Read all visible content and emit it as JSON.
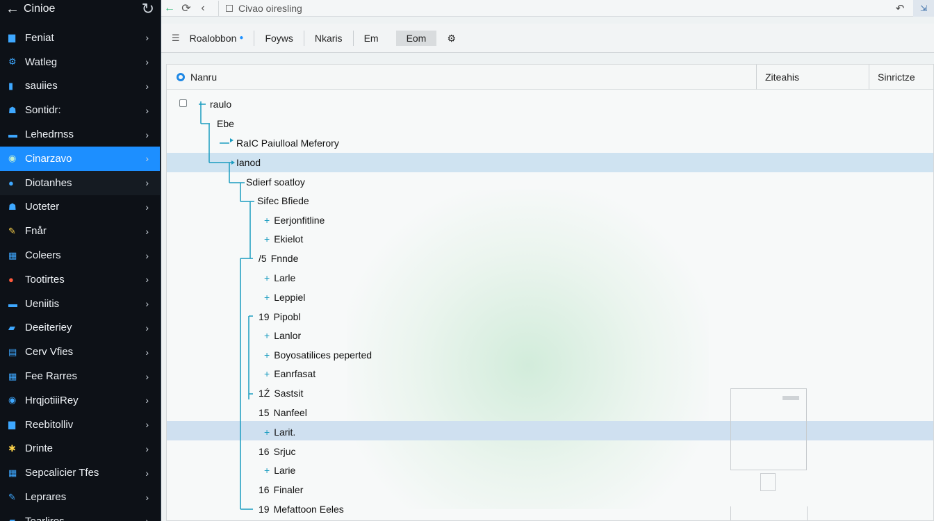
{
  "sidebar": {
    "title": "Cinioe",
    "items": [
      {
        "label": "Feniat",
        "icon": "document-icon"
      },
      {
        "label": "Watleg",
        "icon": "network-icon"
      },
      {
        "label": "sauiies",
        "icon": "book-icon"
      },
      {
        "label": "Sontidr:",
        "icon": "users-icon"
      },
      {
        "label": "Lehedrnss",
        "icon": "card-icon"
      },
      {
        "label": "Cinarzavo",
        "icon": "globe-icon"
      },
      {
        "label": "Diotanhes",
        "icon": "circle-icon"
      },
      {
        "label": "Uoteter",
        "icon": "user-icon"
      },
      {
        "label": "Fnår",
        "icon": "wand-icon"
      },
      {
        "label": "Coleers",
        "icon": "chart-icon"
      },
      {
        "label": "Tootirtes",
        "icon": "person-icon"
      },
      {
        "label": "Ueniitis",
        "icon": "card-icon"
      },
      {
        "label": "Deeiteriey",
        "icon": "folder-icon"
      },
      {
        "label": "Cerv Vfies",
        "icon": "layers-icon"
      },
      {
        "label": "Fee Rarres",
        "icon": "grid-icon"
      },
      {
        "label": "HrqjotiiiRey",
        "icon": "globe-icon"
      },
      {
        "label": "Reebitolliv",
        "icon": "document-icon"
      },
      {
        "label": "Drinte",
        "icon": "star-icon"
      },
      {
        "label": "Sepcalicier Tfes",
        "icon": "grid-icon"
      },
      {
        "label": "Leprares",
        "icon": "pencil-icon"
      },
      {
        "label": "Tearlires",
        "icon": "folder-icon"
      }
    ]
  },
  "topbar": {
    "address": "Civao oiresling"
  },
  "toolbar": {
    "items": [
      "Roalobbon",
      "Foyws",
      "Nkaris",
      "Em",
      "Eom"
    ]
  },
  "table": {
    "headers": {
      "name": "Nanru",
      "col1": "Ziteahis",
      "col2": "Sinrictze"
    }
  },
  "tree": [
    {
      "num": "",
      "label": "raulo",
      "prefix": "none"
    },
    {
      "num": "",
      "label": "Ebe",
      "prefix": "none"
    },
    {
      "num": "",
      "label": "RaIC Paiulloal Meferory",
      "prefix": "none"
    },
    {
      "num": "",
      "label": "Ianod",
      "prefix": "none"
    },
    {
      "num": "",
      "label": "Sdierf soatloy",
      "prefix": "none"
    },
    {
      "num": "",
      "label": "Sifec Bfiede",
      "prefix": "none"
    },
    {
      "num": "",
      "label": "Eerjonfitline",
      "prefix": "plus"
    },
    {
      "num": "",
      "label": "Ekielot",
      "prefix": "plus"
    },
    {
      "num": "/5",
      "label": "Fnnde",
      "prefix": "none"
    },
    {
      "num": "",
      "label": "Larle",
      "prefix": "plus"
    },
    {
      "num": "",
      "label": "Leppiel",
      "prefix": "plus"
    },
    {
      "num": "19",
      "label": "Pipobl",
      "prefix": "none"
    },
    {
      "num": "",
      "label": "Lanlor",
      "prefix": "plus"
    },
    {
      "num": "",
      "label": "Boyosatilices peperted",
      "prefix": "plus"
    },
    {
      "num": "",
      "label": "Eanrfasat",
      "prefix": "plus"
    },
    {
      "num": "1Ź",
      "label": "Sastsit",
      "prefix": "none"
    },
    {
      "num": "15",
      "label": "Nanfeel",
      "prefix": "none"
    },
    {
      "num": "",
      "label": "Larit.",
      "prefix": "plus"
    },
    {
      "num": "16",
      "label": "Srjuc",
      "prefix": "none"
    },
    {
      "num": "",
      "label": "Larie",
      "prefix": "plus"
    },
    {
      "num": "16",
      "label": "Finaler",
      "prefix": "none"
    },
    {
      "num": "19",
      "label": "Mefattoon Eeles",
      "prefix": "none"
    }
  ],
  "colors": {
    "accent": "#1d8fff",
    "tree_line": "#1a9cc0",
    "highlight": "#cfe3f1"
  }
}
